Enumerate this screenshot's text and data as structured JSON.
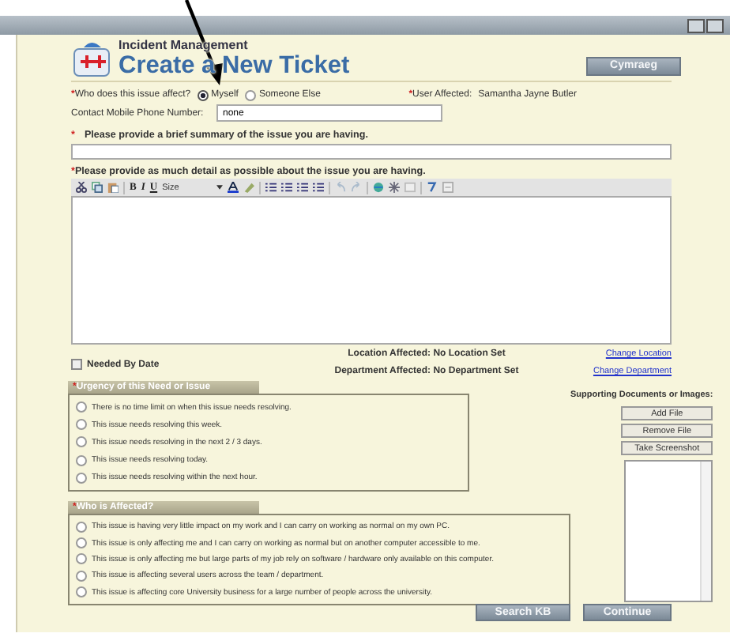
{
  "header": {
    "app": "Incident Management",
    "title": "Create a New Ticket",
    "language_button": "Cymraeg"
  },
  "affect": {
    "label": "Who does this issue affect?",
    "required_mark": "*",
    "options": [
      {
        "label": "Myself",
        "selected": true
      },
      {
        "label": "Someone Else",
        "selected": false
      }
    ]
  },
  "user_affected": {
    "label": "User Affected:",
    "required_mark": "*",
    "value": "Samantha Jayne Butler"
  },
  "phone": {
    "label": "Contact Mobile Phone Number:",
    "value": "none"
  },
  "summary": {
    "label": "Please provide a brief summary of the issue you are having.",
    "required_mark": "*"
  },
  "detail": {
    "label": "Please provide as much detail as possible about the issue you are having.",
    "required_mark": "*",
    "toolbar": {
      "bold": "B",
      "italic": "I",
      "underline": "U",
      "size": "Size"
    }
  },
  "needed_by_date": {
    "label": "Needed By Date",
    "checked": false
  },
  "location": {
    "label": "Location Affected:",
    "value": "No Location Set",
    "link": "Change Location"
  },
  "department": {
    "label": "Department Affected:",
    "value": "No Department Set",
    "link": "Change Department"
  },
  "urgency": {
    "title": "Urgency of this Need or Issue",
    "required_mark": "*",
    "options": [
      {
        "label": "There is no time limit on when this issue needs resolving.",
        "selected": false
      },
      {
        "label": "This issue needs resolving this week.",
        "selected": false
      },
      {
        "label": "This issue needs resolving in the next 2 / 3 days.",
        "selected": false
      },
      {
        "label": "This issue needs resolving today.",
        "selected": false
      },
      {
        "label": "This issue needs resolving within the next hour.",
        "selected": false
      }
    ]
  },
  "who_affected": {
    "title": "Who is Affected?",
    "required_mark": "*",
    "options": [
      {
        "label": "This issue is having very little impact on my work and I can carry on working as normal on my own PC.",
        "selected": false
      },
      {
        "label": "This issue is only affecting me and I can carry on working as normal but on another computer accessible to me.",
        "selected": false
      },
      {
        "label": "This issue is only affecting me but large parts of my job rely on software / hardware only available on this computer.",
        "selected": false
      },
      {
        "label": "This issue is affecting several users across the team / department.",
        "selected": false
      },
      {
        "label": "This issue is affecting core University business for a large number of people across the university.",
        "selected": false
      }
    ]
  },
  "attachments": {
    "label": "Supporting Documents or Images:",
    "buttons": [
      "Add File",
      "Remove File",
      "Take Screenshot"
    ]
  },
  "footer_buttons": [
    "Search KB",
    "Continue"
  ],
  "annotation": {
    "kind": "arrow"
  }
}
